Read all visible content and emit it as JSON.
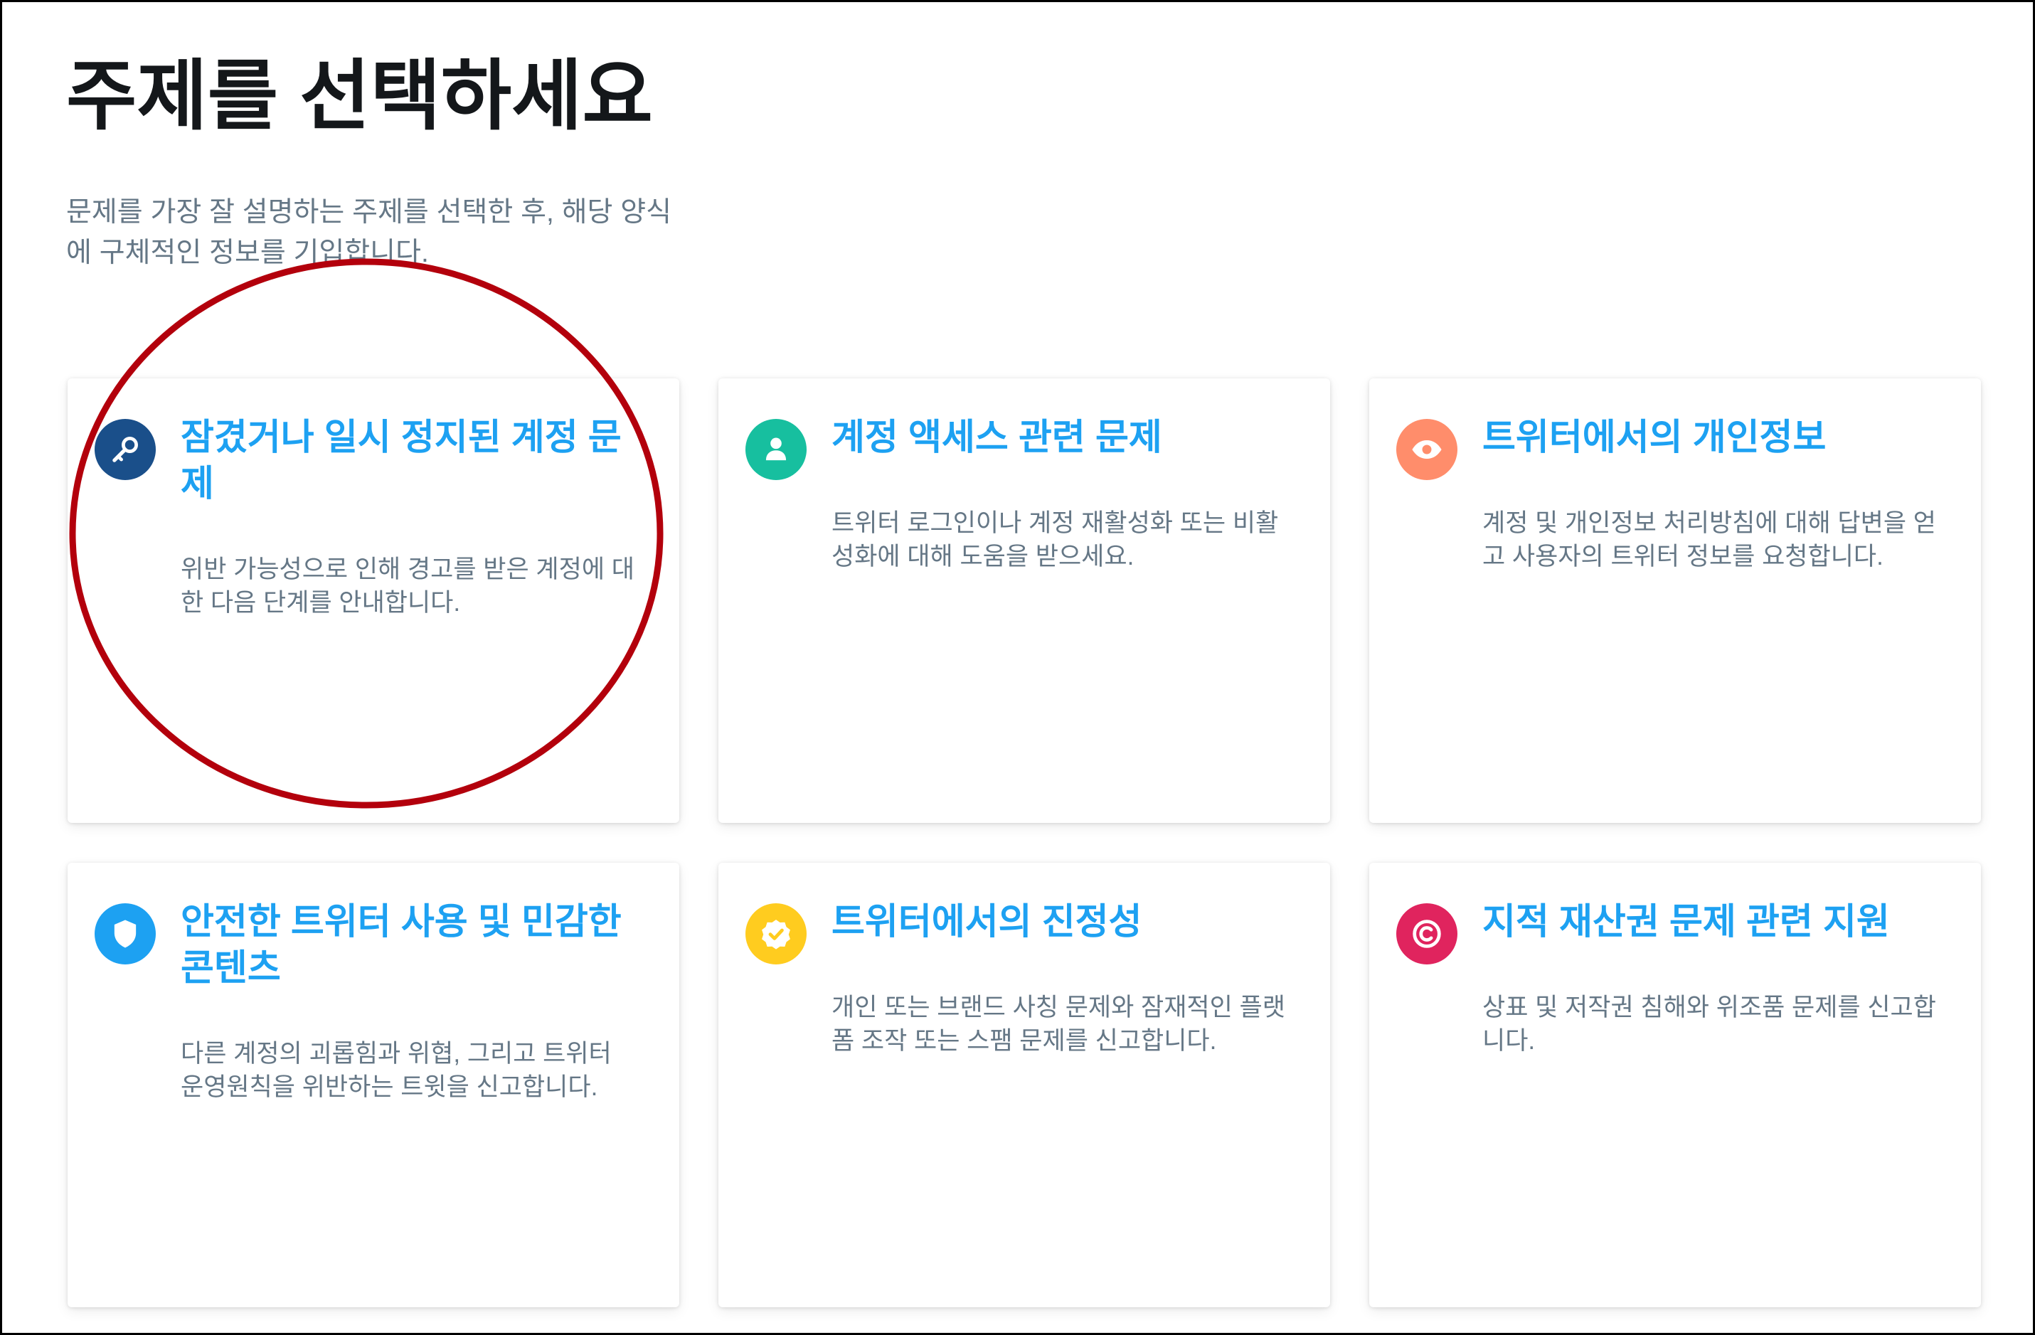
{
  "page": {
    "title": "주제를 선택하세요",
    "subtitle": "문제를 가장 잘 설명하는 주제를 선택한 후, 해당 양식에 구체적인 정보를 기입합니다."
  },
  "cards": [
    {
      "title": "잠겼거나 일시 정지된 계정 문제",
      "description": "위반 가능성으로 인해 경고를 받은 계정에 대한 다음 단계를 안내합니다.",
      "icon": "key-icon",
      "icon_color": "#1a4f8a"
    },
    {
      "title": "계정 액세스 관련 문제",
      "description": "트위터 로그인이나 계정 재활성화 또는 비활성화에 대해 도움을 받으세요.",
      "icon": "user-icon",
      "icon_color": "#17bf9f"
    },
    {
      "title": "트위터에서의 개인정보",
      "description": "계정 및 개인정보 처리방침에 대해 답변을 얻고 사용자의 트위터 정보를 요청합니다.",
      "icon": "eye-icon",
      "icon_color": "#ff8d6b"
    },
    {
      "title": "안전한 트위터 사용 및 민감한 콘텐츠",
      "description": "다른 계정의 괴롭힘과 위협, 그리고 트위터 운영원칙을 위반하는 트윗을 신고합니다.",
      "icon": "shield-icon",
      "icon_color": "#1da1f2"
    },
    {
      "title": "트위터에서의 진정성",
      "description": "개인 또는 브랜드 사칭 문제와 잠재적인 플랫폼 조작 또는 스팸 문제를 신고합니다.",
      "icon": "verified-badge-icon",
      "icon_color": "#ffcc1f"
    },
    {
      "title": "지적 재산권 문제 관련 지원",
      "description": "상표 및 저작권 침해와 위조품 문제를 신고합니다.",
      "icon": "copyright-icon",
      "icon_color": "#e0245e"
    }
  ],
  "colors": {
    "title_text": "#14171a",
    "muted_text": "#657786",
    "link_blue": "#1da1f2",
    "annotation_red": "#b3000c"
  }
}
